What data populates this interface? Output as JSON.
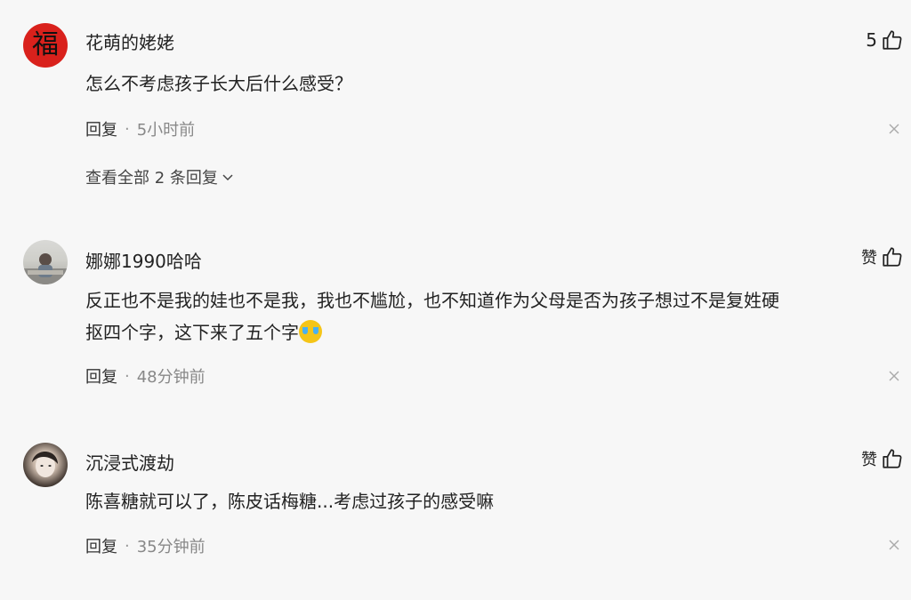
{
  "comments": [
    {
      "username": "花萌的姥姥",
      "avatar_text": "福",
      "text": "怎么不考虑孩子长大后什么感受？",
      "reply_label": "回复",
      "time": "5小时前",
      "like_label": "5",
      "expand_label": "查看全部 2 条回复"
    },
    {
      "username": "娜娜1990哈哈",
      "text_line1": "反正也不是我的娃也不是我，我也不尴尬，也不知道作为父母是否为孩子想过不是复姓硬",
      "text_line2": "抠四个字，这下来了五个字",
      "reply_label": "回复",
      "time": "48分钟前",
      "like_label": "赞"
    },
    {
      "username": "沉浸式渡劫",
      "text": "陈喜糖就可以了，陈皮话梅糖...考虑过孩子的感受嘛",
      "reply_label": "回复",
      "time": "35分钟前",
      "like_label": "赞"
    }
  ],
  "separator": "·"
}
